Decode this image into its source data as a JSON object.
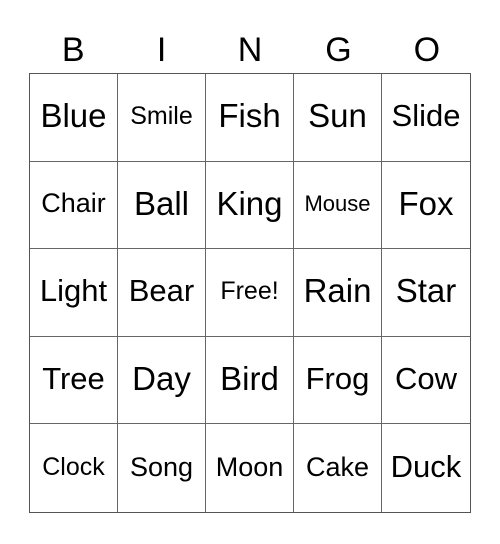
{
  "header": [
    "B",
    "I",
    "N",
    "G",
    "O"
  ],
  "rows": [
    [
      "Blue",
      "Smile",
      "Fish",
      "Sun",
      "Slide"
    ],
    [
      "Chair",
      "Ball",
      "King",
      "Mouse",
      "Fox"
    ],
    [
      "Light",
      "Bear",
      "Free!",
      "Rain",
      "Star"
    ],
    [
      "Tree",
      "Day",
      "Bird",
      "Frog",
      "Cow"
    ],
    [
      "Clock",
      "Song",
      "Moon",
      "Cake",
      "Duck"
    ]
  ],
  "free_space": "Free!"
}
